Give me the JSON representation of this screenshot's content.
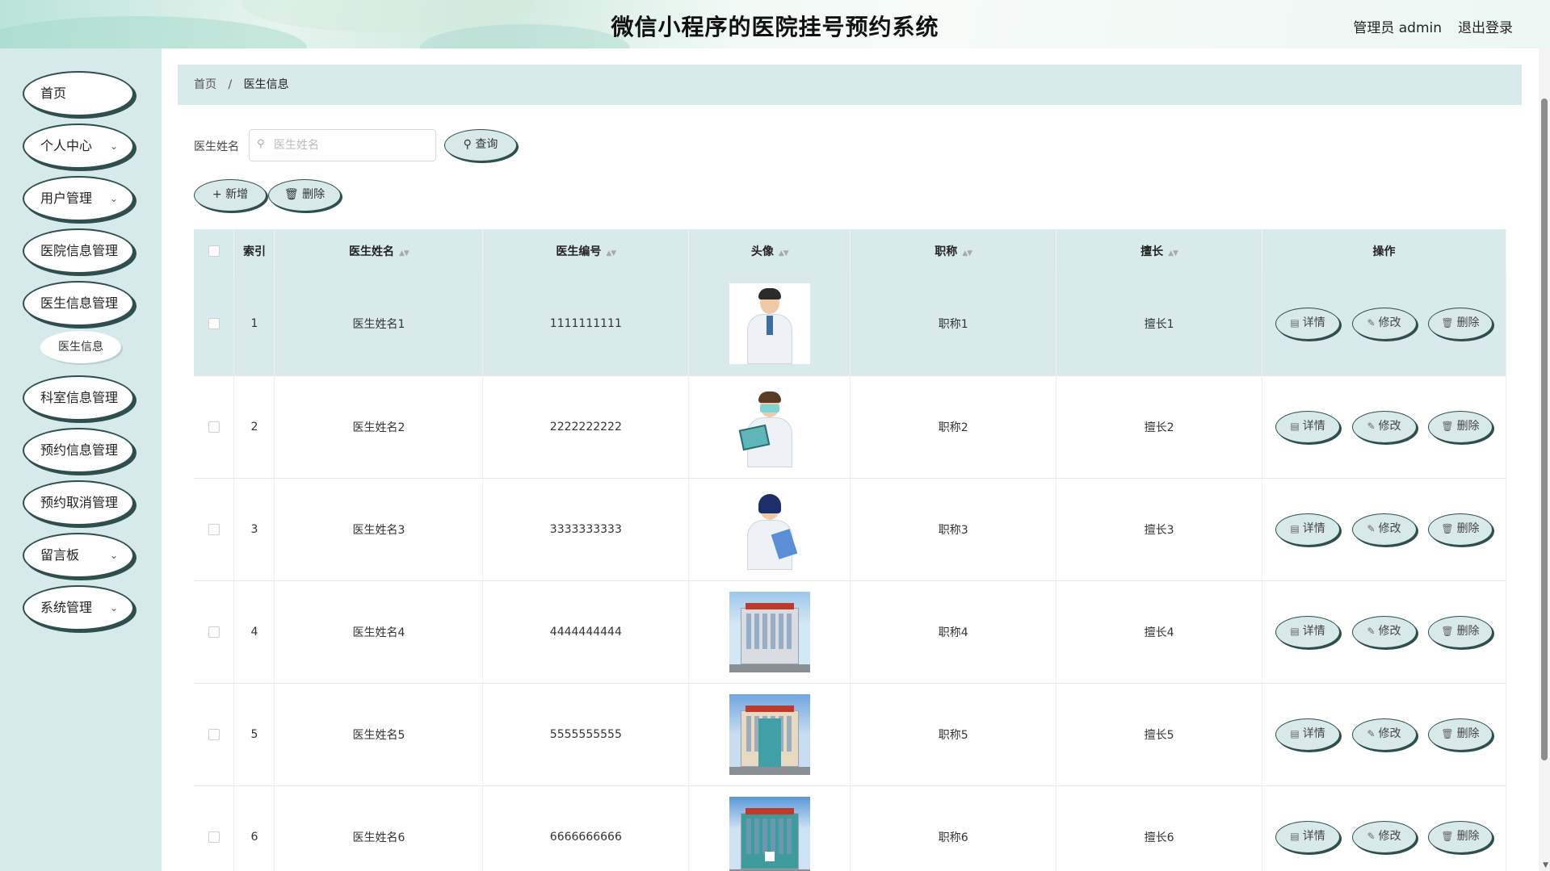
{
  "header": {
    "title": "微信小程序的医院挂号预约系统",
    "user": "管理员 admin",
    "logout": "退出登录"
  },
  "sidebar": {
    "items": [
      {
        "label": "首页",
        "chevron": false
      },
      {
        "label": "个人中心",
        "chevron": true
      },
      {
        "label": "用户管理",
        "chevron": true
      },
      {
        "label": "医院信息管理",
        "chevron": false
      },
      {
        "label": "医生信息管理",
        "chevron": false
      },
      {
        "label": "科室信息管理",
        "chevron": false
      },
      {
        "label": "预约信息管理",
        "chevron": false
      },
      {
        "label": "预约取消管理",
        "chevron": false
      },
      {
        "label": "留言板",
        "chevron": true
      },
      {
        "label": "系统管理",
        "chevron": true
      }
    ],
    "sub_item": "医生信息",
    "chevron_glyph": "⌄"
  },
  "breadcrumb": {
    "home": "首页",
    "separator": "/",
    "current": "医生信息"
  },
  "search": {
    "label": "医生姓名",
    "placeholder": "医生姓名",
    "query_button": "查询"
  },
  "toolbar": {
    "add": "新增",
    "delete": "删除"
  },
  "table": {
    "columns": [
      "",
      "索引",
      "医生姓名",
      "医生编号",
      "头像",
      "职称",
      "擅长",
      "操作"
    ],
    "rows": [
      {
        "index": "1",
        "name": "医生姓名1",
        "code": "1111111111",
        "avatar": "doctor-illustration",
        "title": "职称1",
        "specialty": "擅长1",
        "highlighted": true
      },
      {
        "index": "2",
        "name": "医生姓名2",
        "code": "2222222222",
        "avatar": "doctor-illustration",
        "title": "职称2",
        "specialty": "擅长2",
        "highlighted": false
      },
      {
        "index": "3",
        "name": "医生姓名3",
        "code": "3333333333",
        "avatar": "doctor-illustration",
        "title": "职称3",
        "specialty": "擅长3",
        "highlighted": false
      },
      {
        "index": "4",
        "name": "医生姓名4",
        "code": "4444444444",
        "avatar": "hospital-photo",
        "title": "职称4",
        "specialty": "擅长4",
        "highlighted": false
      },
      {
        "index": "5",
        "name": "医生姓名5",
        "code": "5555555555",
        "avatar": "hospital-photo",
        "title": "职称5",
        "specialty": "擅长5",
        "highlighted": false
      },
      {
        "index": "6",
        "name": "医生姓名6",
        "code": "6666666666",
        "avatar": "hospital-photo",
        "title": "职称6",
        "specialty": "擅长6",
        "highlighted": false
      }
    ],
    "actions": {
      "detail": "详情",
      "edit": "修改",
      "delete": "删除"
    }
  },
  "colors": {
    "accent": "#d8eaec",
    "sidebar_bg": "#d6e9eb",
    "outline": "#2f4f4f"
  }
}
